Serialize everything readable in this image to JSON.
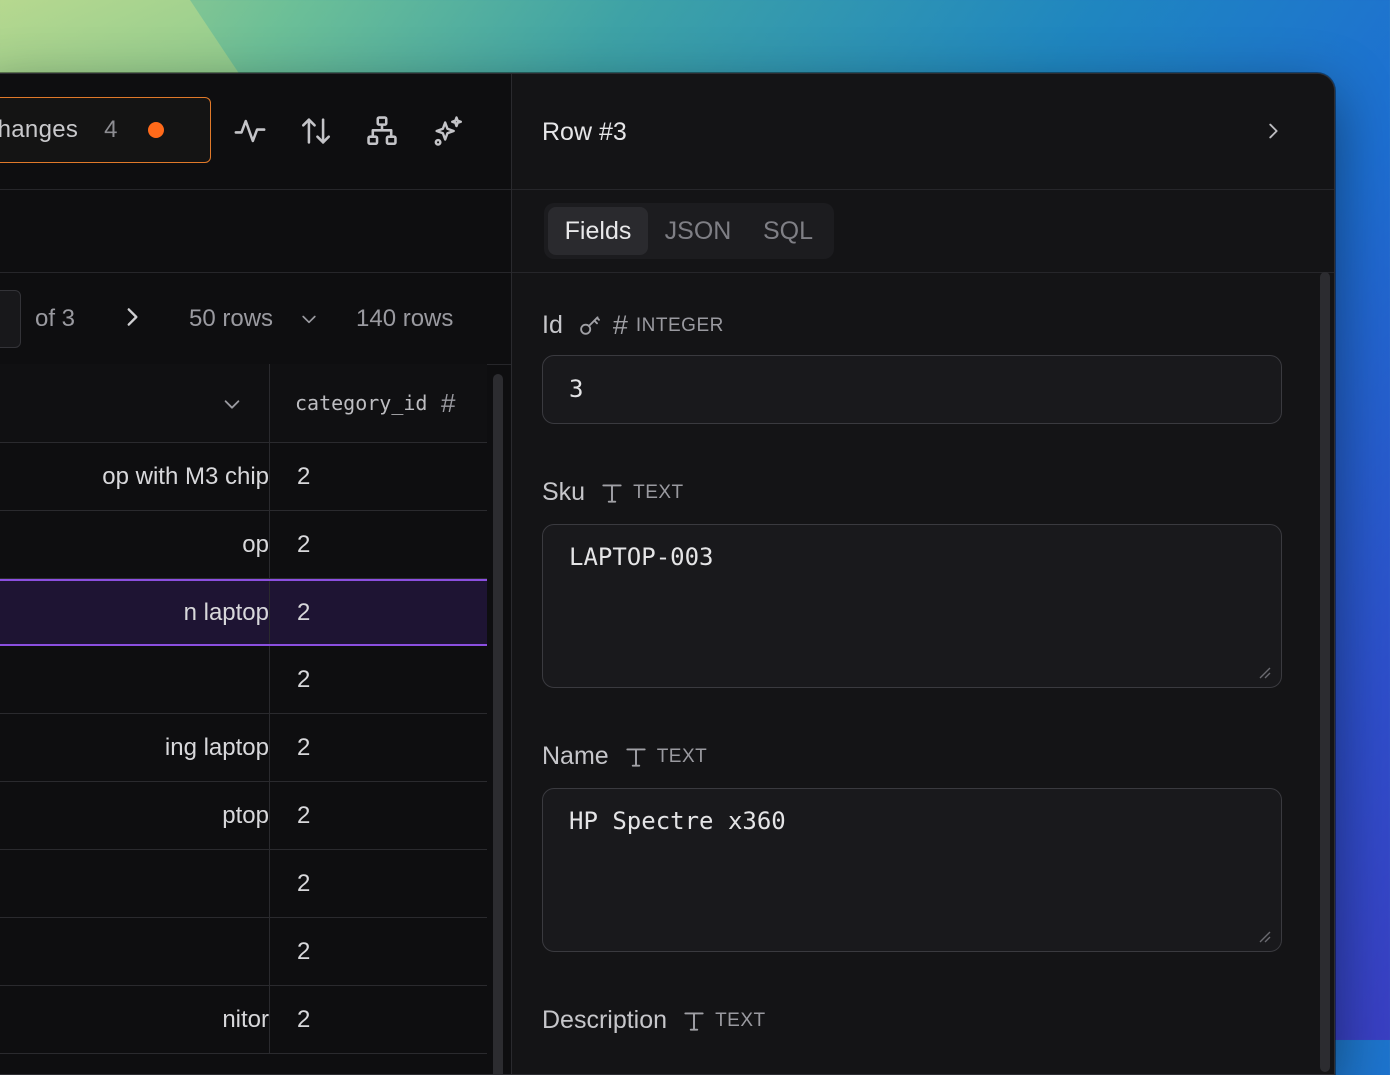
{
  "toolbar": {
    "changes_label": "Changes",
    "changes_count": "4",
    "accent_color": "#ff6a1a",
    "icons": [
      "activity-icon",
      "sort-icon",
      "hierarchy-icon",
      "sparkles-icon"
    ]
  },
  "pager": {
    "of_label": "of 3",
    "page_size": "50 rows",
    "total_rows": "140 rows"
  },
  "table": {
    "column_header": "category_id",
    "rows": [
      {
        "name": "op with M3 chip",
        "category_id": "2"
      },
      {
        "name": "op",
        "category_id": "2"
      },
      {
        "name": "n laptop",
        "category_id": "2",
        "selected": true
      },
      {
        "name": "",
        "category_id": "2"
      },
      {
        "name": "ing laptop",
        "category_id": "2"
      },
      {
        "name": "ptop",
        "category_id": "2"
      },
      {
        "name": "",
        "category_id": "2"
      },
      {
        "name": "",
        "category_id": "2"
      },
      {
        "name": "nitor",
        "category_id": "2"
      }
    ],
    "selected_color": "#8b4fe0"
  },
  "detail": {
    "title": "Row #3",
    "tabs": [
      "Fields",
      "JSON",
      "SQL"
    ],
    "active_tab": "Fields",
    "fields": [
      {
        "label": "Id",
        "type": "INTEGER",
        "value": "3"
      },
      {
        "label": "Sku",
        "type": "TEXT",
        "value": "LAPTOP-003"
      },
      {
        "label": "Name",
        "type": "TEXT",
        "value": "HP Spectre x360"
      },
      {
        "label": "Description",
        "type": "TEXT"
      }
    ]
  }
}
